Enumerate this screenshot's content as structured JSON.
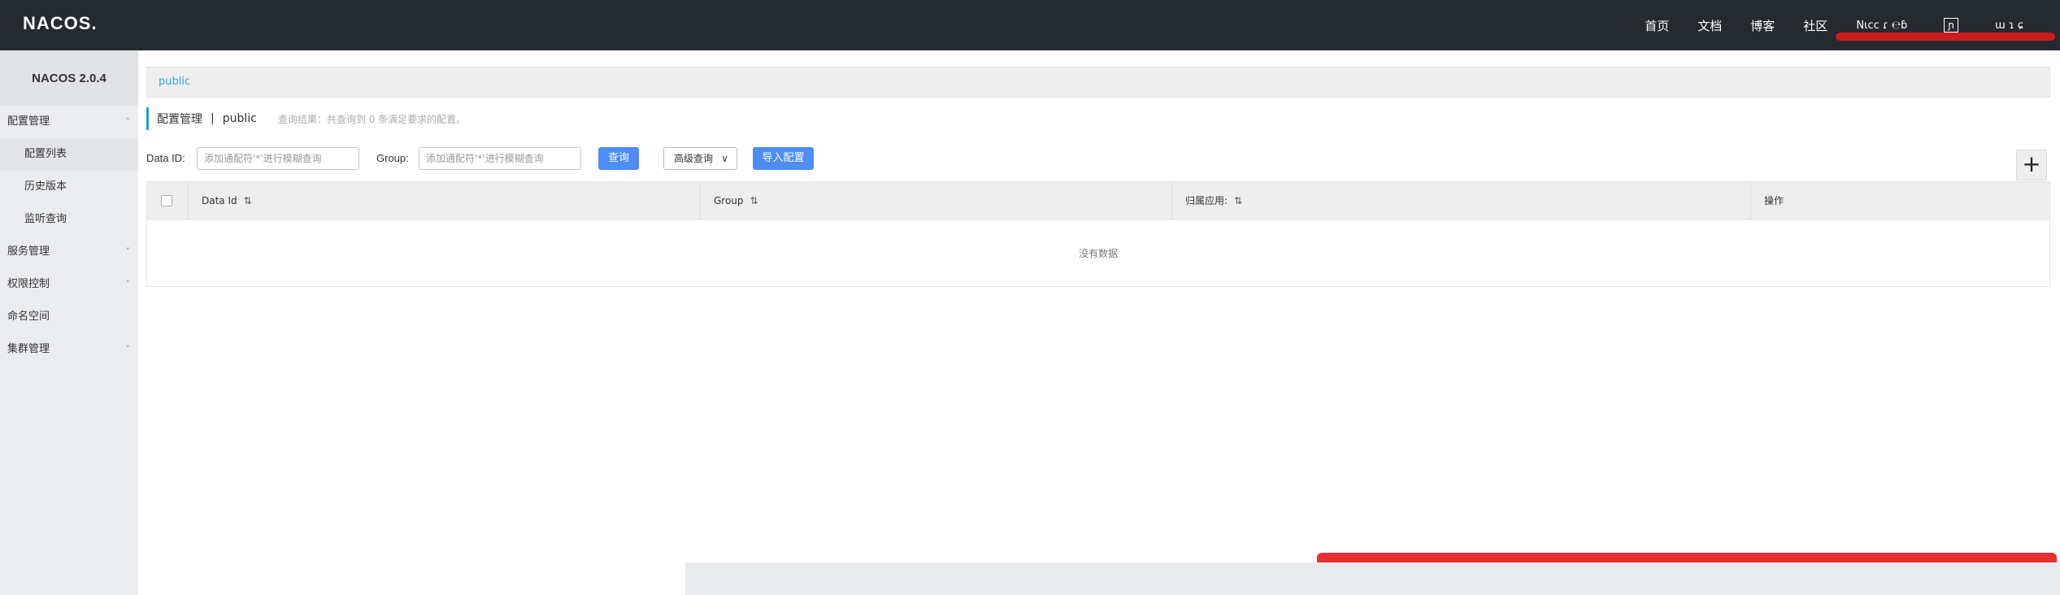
{
  "header": {
    "logo": "NACOS.",
    "nav": [
      "首页",
      "文档",
      "博客",
      "社区"
    ],
    "garbled_text": "Nιcc  ɾ  ℮ɓ",
    "box_text": "ɲ",
    "garbled_text2": "ɯ ɿ ɕ"
  },
  "sidebar": {
    "title": "NACOS 2.0.4",
    "items": [
      {
        "label": "配置管理",
        "expanded": true
      },
      {
        "label": "配置列表",
        "sub": true,
        "active": true
      },
      {
        "label": "历史版本",
        "sub": true
      },
      {
        "label": "监听查询",
        "sub": true
      },
      {
        "label": "服务管理",
        "collapsed": true
      },
      {
        "label": "权限控制",
        "collapsed": true
      },
      {
        "label": "命名空间"
      },
      {
        "label": "集群管理",
        "collapsed": true
      }
    ]
  },
  "breadcrumb": "public",
  "page": {
    "title": "配置管理",
    "separator": "|",
    "namespace": "public",
    "result_note": "查询结果：共查询到 0 条满足要求的配置。"
  },
  "filters": {
    "data_id_label": "Data ID:",
    "data_id_placeholder": "添加通配符'*'进行模糊查询",
    "group_label": "Group:",
    "group_placeholder": "添加通配符'*'进行模糊查询",
    "search_button": "查询",
    "advanced_button": "高级查询",
    "import_button": "导入配置"
  },
  "add_button": "+",
  "table": {
    "columns": [
      "Data Id",
      "Group",
      "归属应用:",
      "操作"
    ],
    "sort_icon": "⇅",
    "empty_text": "没有数据"
  },
  "colors": {
    "header_bg": "#252a2f",
    "primary": "#4e8cf6",
    "accent": "#1e9fd8",
    "watermark_red": "#e11a1a"
  }
}
